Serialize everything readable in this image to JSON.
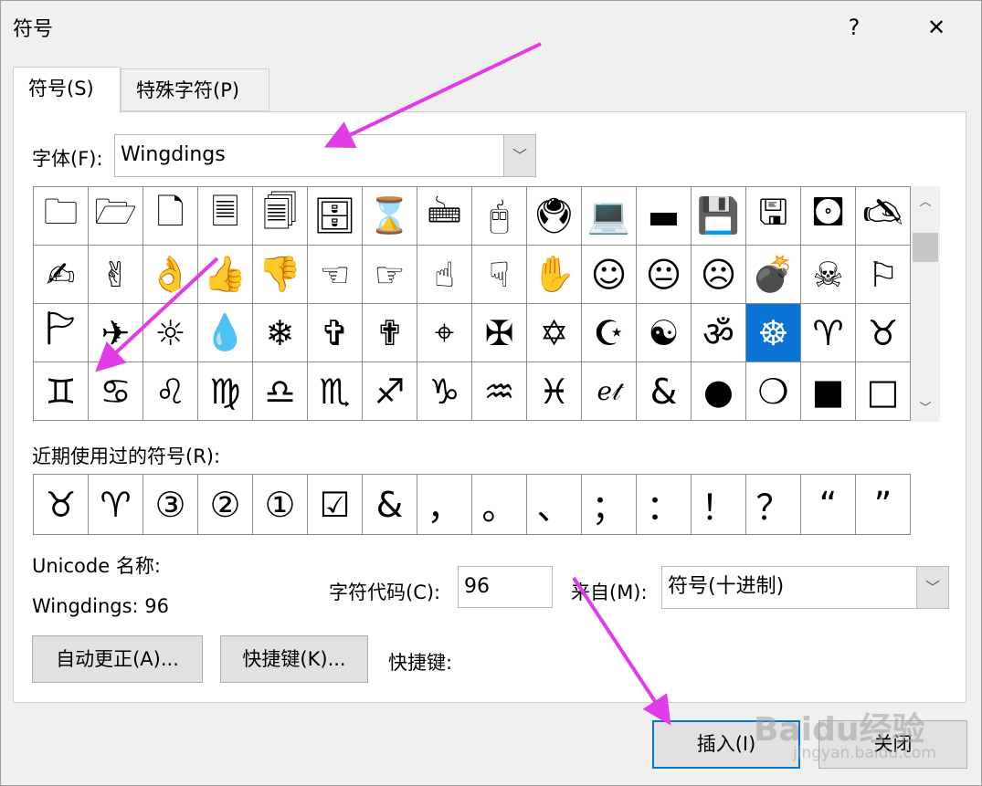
{
  "window": {
    "title": "符号",
    "help_label": "?",
    "close_label": "✕"
  },
  "tabs": [
    {
      "label": "符号(S)",
      "active": true
    },
    {
      "label": "特殊字符(P)",
      "active": false
    }
  ],
  "font": {
    "label": "字体(F):",
    "value": "Wingdings",
    "arrow": "﹀"
  },
  "symbol_grid": {
    "selected_index": 45,
    "symbols": [
      "🗀",
      "🗁",
      "🗋",
      "🗏",
      "🗐",
      "🗄",
      "⌛",
      "🖮",
      "🖰",
      "🖲",
      "💻",
      "▬",
      "💾",
      "🖫",
      "🖸",
      "🖎",
      "✍",
      "✌",
      "👌",
      "👍",
      "👎",
      "☜",
      "☞",
      "☝",
      "☟",
      "✋",
      "☺",
      "😐",
      "☹",
      "💣",
      "☠",
      "⚐",
      "🏱",
      "✈",
      "☼",
      "💧",
      "❄",
      "✞",
      "✟",
      "⌖",
      "✠",
      "✡",
      "☪",
      "☯",
      "ॐ",
      "☸",
      "♈",
      "♉",
      "♊",
      "♋",
      "♌",
      "♍",
      "♎",
      "♏",
      "♐",
      "♑",
      "♒",
      "♓",
      "ℯ𝓉",
      "&",
      "●",
      "❍",
      "■",
      "□"
    ]
  },
  "scroll": {
    "up": "︿",
    "down": "﹀"
  },
  "recent": {
    "label": "近期使用过的符号(R):",
    "symbols": [
      "♉",
      "♈",
      "③",
      "②",
      "①",
      "☑",
      "&",
      "，",
      "。",
      "、",
      "；",
      "：",
      "！",
      "？",
      "“",
      "”"
    ]
  },
  "unicode_name": {
    "label": "Unicode 名称:",
    "value": "Wingdings: 96"
  },
  "char_code": {
    "label": "字符代码(C):",
    "value": "96"
  },
  "from": {
    "label": "来自(M):",
    "value": "符号(十进制)",
    "arrow": "﹀"
  },
  "buttons": {
    "autocorrect": "自动更正(A)...",
    "shortcut_key_button": "快捷键(K)...",
    "shortcut_key_label": "快捷键:",
    "insert": "插入(I)",
    "close": "关闭"
  },
  "watermark": {
    "brand": "Baidu经验",
    "url": "jingyan.baidu.com"
  },
  "colors": {
    "selection": "#0a74d6",
    "annotation_arrow": "#e23be8",
    "default_button_border": "#0078d7"
  }
}
